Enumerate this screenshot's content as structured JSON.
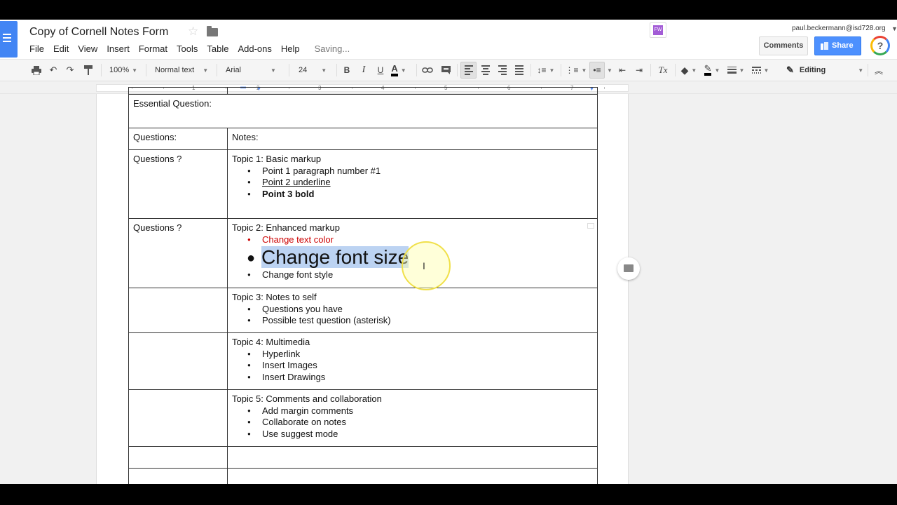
{
  "doc": {
    "title": "Copy of Cornell Notes Form",
    "status": "Saving..."
  },
  "menu": [
    "File",
    "Edit",
    "View",
    "Insert",
    "Format",
    "Tools",
    "Table",
    "Add-ons",
    "Help"
  ],
  "account": {
    "email": "paul.beckermann@isd728.org",
    "comments_label": "Comments",
    "share_label": "Share",
    "addon_label": "FW"
  },
  "toolbar": {
    "zoom": "100%",
    "style": "Normal text",
    "font": "Arial",
    "size": "24",
    "bold": "B",
    "italic": "I",
    "underline": "U",
    "text_color": "A",
    "clear_format": "Tx",
    "mode": "Editing"
  },
  "ruler": [
    "1",
    "2",
    "3",
    "4",
    "5",
    "6",
    "7"
  ],
  "table": {
    "essential": "Essential Question:",
    "questions_header": "Questions:",
    "notes_header": "Notes:",
    "topic1": {
      "question": "Questions ?",
      "title": "Topic 1: Basic markup",
      "points": [
        "Point 1 paragraph number #1",
        "Point 2 underline",
        "Point 3 bold"
      ]
    },
    "topic2": {
      "question": "Questions ?",
      "title": "Topic 2: Enhanced markup",
      "points": [
        "Change text color",
        "Change font size",
        "Change font style"
      ]
    },
    "topic3": {
      "title": "Topic 3: Notes to self",
      "points": [
        "Questions you have",
        "Possible test question (asterisk)"
      ]
    },
    "topic4": {
      "title": "Topic 4: Multimedia",
      "points": [
        "Hyperlink",
        "Insert Images",
        "Insert Drawings"
      ]
    },
    "topic5": {
      "title": "Topic 5: Comments and collaboration",
      "points": [
        "Add margin comments",
        "Collaborate on notes",
        "Use suggest mode"
      ]
    }
  },
  "colors": {
    "docs_blue": "#4285f4",
    "share_blue": "#4d90fe",
    "red_text": "#cc0000",
    "selection": "#bcd3f2"
  }
}
